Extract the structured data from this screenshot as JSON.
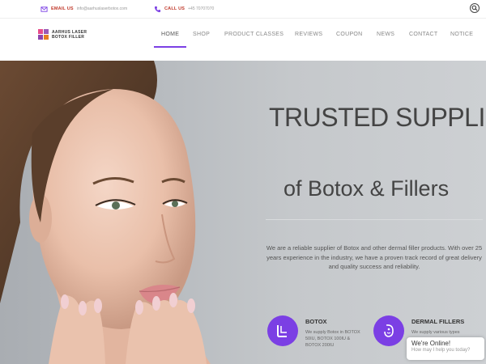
{
  "topbar": {
    "email_label": "EMAIL US",
    "email_value": "info@aarhuslaserbotox.com",
    "call_label": "CALL US",
    "call_value": "+45 70707070"
  },
  "logo": {
    "line1": "AARHUS LASER",
    "line2": "BOTOX FILLER"
  },
  "nav": {
    "items": [
      "HOME",
      "SHOP",
      "PRODUCT CLASSES",
      "REVIEWS",
      "COUPON",
      "NEWS",
      "CONTACT",
      "NOTICE"
    ],
    "active": "HOME"
  },
  "hero": {
    "title": "TRUSTED SUPPLIER",
    "subtitle": "of Botox & Fillers",
    "description": "We are a reliable supplier of Botox and other dermal filler products. With over 25 years experience in the industry, we have a proven track record of great delivery and quality success and reliability."
  },
  "features": [
    {
      "title": "BOTOX",
      "text": "We supply Botox in BOTOX 50IU, BOTOX 100IU & BOTOX 200IU",
      "icon": "syringe-icon"
    },
    {
      "title": "DERMAL FILLERS",
      "text": "We supply various types",
      "icon": "face-icon"
    }
  ],
  "chat": {
    "title": "We're Online!",
    "subtitle": "How may I help you today?"
  },
  "colors": {
    "accent": "#7b3fe4",
    "topbar_label": "#c0392b"
  }
}
